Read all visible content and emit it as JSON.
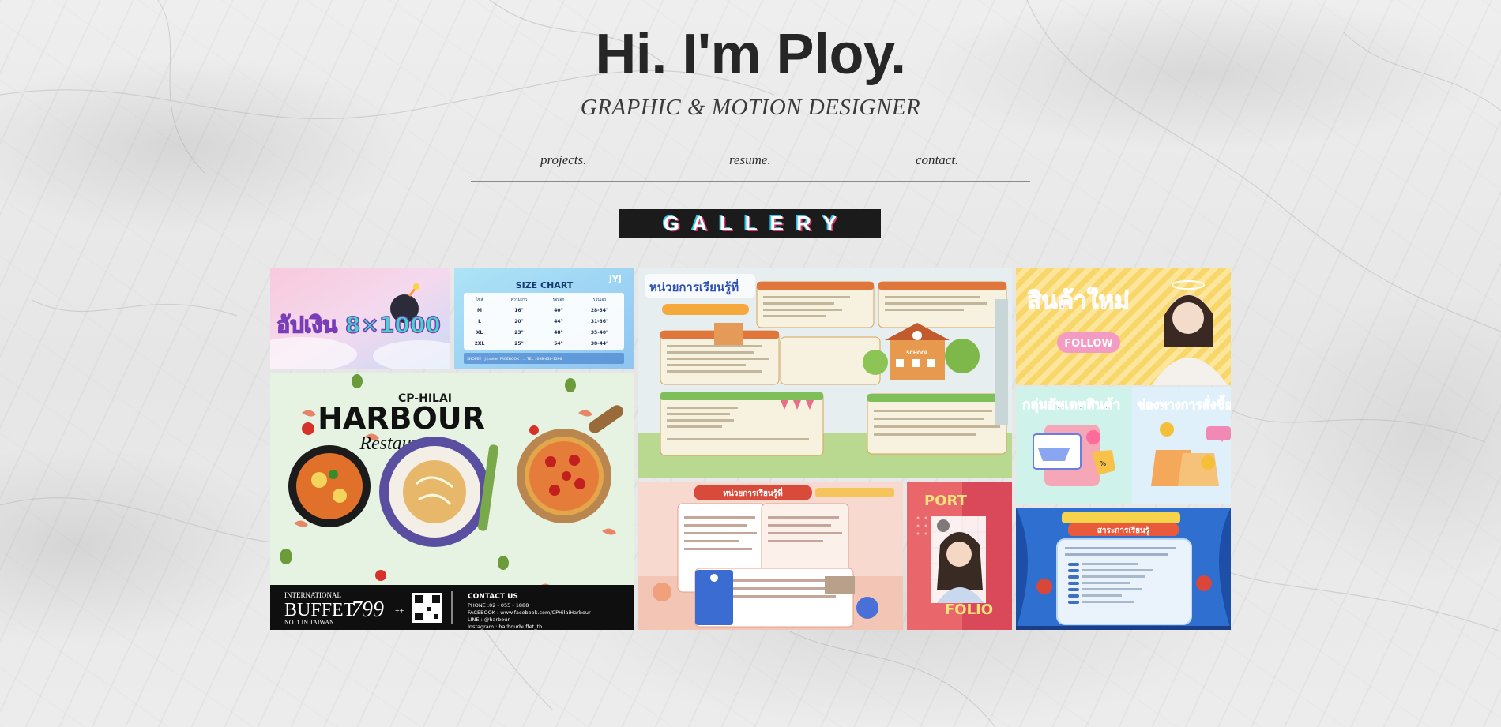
{
  "header": {
    "title": "Hi. I'm Ploy.",
    "subtitle": "GRAPHIC & MOTION DESIGNER"
  },
  "nav": {
    "items": [
      {
        "label": "projects."
      },
      {
        "label": "resume."
      },
      {
        "label": "contact."
      }
    ]
  },
  "gallery": {
    "banner": "GALLERY",
    "tiles": {
      "sale": {
        "text": "อัปเงิน 8×1000"
      },
      "sizechart": {
        "title": "SIZE CHART",
        "brand": "JYJ",
        "headers": [
          "ไซส์",
          "ความยาว",
          "รอบอก",
          "รอบเอว"
        ],
        "rows": [
          [
            "M",
            "16\"",
            "40\"",
            "28-34\""
          ],
          [
            "L",
            "20\"",
            "44\"",
            "31-36\""
          ],
          [
            "XL",
            "23\"",
            "48\"",
            "35-40\""
          ],
          [
            "2XL",
            "25\"",
            "54\"",
            "38-44\""
          ]
        ],
        "footer": "SHOPEE : J.J.seller   FACEBOOK : ...   TEL : 098-438-1396"
      },
      "harbour": {
        "brand_top": "CP-HILAI",
        "brand_main": "HARBOUR",
        "brand_script": "Restaurant",
        "buffet_small": "INTERNATIONAL",
        "buffet_word": "BUFFET",
        "buffet_tag": "NO. 1 IN TAIWAN",
        "price": "799",
        "price_suffix": "++",
        "contact_title": "CONTACT US",
        "contact_lines": [
          "PHONE :02 - 055 - 1888",
          "FACEBOOK : www.facebook.com/CPHilaiHarbour",
          "LINE : @harbour",
          "Instagram : harbourbuffet_th"
        ]
      },
      "lesson1": {
        "title": "หน่วยการเรียนรู้ที่",
        "school": "SCHOOL"
      },
      "newproduct": {
        "title": "สินค้าใหม่",
        "button": "FOLLOW"
      },
      "group": {
        "title": "กลุ่มอัพเดทสินค้า"
      },
      "channel": {
        "title": "ช่องทางการสั่งซื้อ"
      },
      "lesson2": {
        "title": "หน่วยการเรียนรู้ที่"
      },
      "portfolio": {
        "top": "PORT",
        "bottom": "FOLIO"
      },
      "content": {
        "title": "สาระการเรียนรู้"
      }
    }
  }
}
